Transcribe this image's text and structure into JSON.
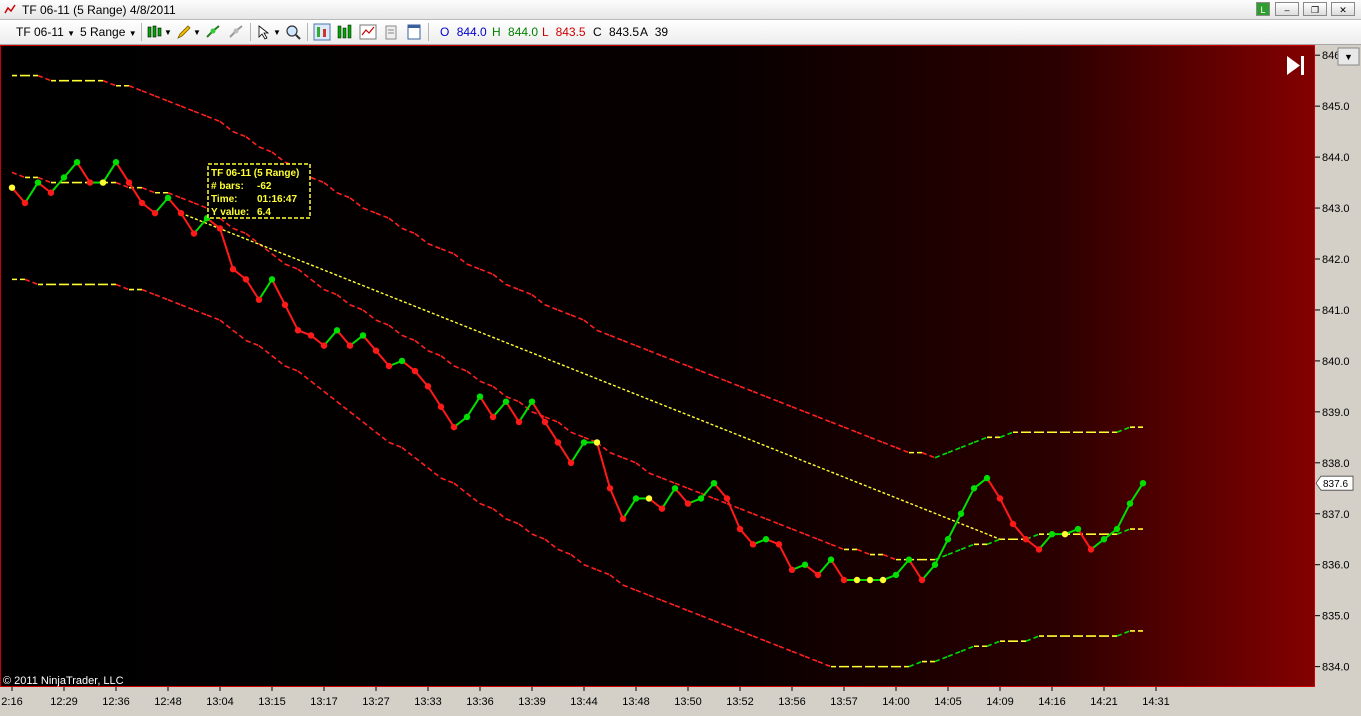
{
  "window": {
    "title": "TF 06-11 (5 Range)  4/8/2011",
    "app_icon": "chart-icon",
    "buttons": {
      "restore_icon": "restore-icon",
      "close_icon": "close-icon"
    }
  },
  "toolbar": {
    "instrument": "TF 06-11",
    "interval": "5 Range",
    "ohlc": {
      "o_label": "O",
      "o_value": "844.0",
      "h_label": "H",
      "h_value": "844.0",
      "l_label": "L",
      "l_value": "843.5",
      "c_label": "C",
      "c_value": "843.5",
      "a_label": "A",
      "a_value": "39"
    },
    "icons": [
      "bar-type-icon",
      "pencil-draw-icon",
      "add-indicator-icon",
      "strategy-icon",
      "cursor-icon",
      "zoom-icon",
      "data-box-icon",
      "chart-properties-icon",
      "indicator-icon",
      "strategy-properties-icon",
      "templates-icon"
    ],
    "colors": {
      "o": "#0000cc",
      "h": "#008000",
      "l": "#cc0000",
      "c": "#000000"
    }
  },
  "chart_data": {
    "type": "line",
    "instrument": "TF 06-11",
    "interval": "5 Range",
    "date": "4/8/2011",
    "copyright": "© 2011 NinjaTrader, LLC",
    "current_price_label": "837.6",
    "ylim": [
      833.6,
      846.2
    ],
    "yticks": [
      834.0,
      835.0,
      836.0,
      837.0,
      838.0,
      839.0,
      840.0,
      841.0,
      842.0,
      843.0,
      844.0,
      845.0,
      846.0
    ],
    "ytick_labels": [
      "834.0",
      "835.0",
      "836.0",
      "837.0",
      "838.0",
      "839.0",
      "840.0",
      "841.0",
      "842.0",
      "843.0",
      "844.0",
      "845.0",
      "846.0"
    ],
    "xticks": [
      {
        "bar": 0,
        "label": "2:16"
      },
      {
        "bar": 4,
        "label": "12:29"
      },
      {
        "bar": 8,
        "label": "12:36"
      },
      {
        "bar": 12,
        "label": "12:48"
      },
      {
        "bar": 16,
        "label": "13:04"
      },
      {
        "bar": 20,
        "label": "13:15"
      },
      {
        "bar": 24,
        "label": "13:17"
      },
      {
        "bar": 28,
        "label": "13:27"
      },
      {
        "bar": 32,
        "label": "13:33"
      },
      {
        "bar": 36,
        "label": "13:36"
      },
      {
        "bar": 40,
        "label": "13:39"
      },
      {
        "bar": 44,
        "label": "13:44"
      },
      {
        "bar": 48,
        "label": "13:48"
      },
      {
        "bar": 52,
        "label": "13:50"
      },
      {
        "bar": 56,
        "label": "13:52"
      },
      {
        "bar": 60,
        "label": "13:56"
      },
      {
        "bar": 64,
        "label": "13:57"
      },
      {
        "bar": 68,
        "label": "14:00"
      },
      {
        "bar": 72,
        "label": "14:05"
      },
      {
        "bar": 76,
        "label": "14:09"
      },
      {
        "bar": 80,
        "label": "14:16"
      },
      {
        "bar": 84,
        "label": "14:21"
      },
      {
        "bar": 88,
        "label": "14:31"
      }
    ],
    "series": [
      {
        "role": "price-close",
        "values": [
          843.4,
          843.1,
          843.5,
          843.3,
          843.6,
          843.9,
          843.5,
          843.5,
          843.9,
          843.5,
          843.1,
          842.9,
          843.2,
          842.9,
          842.5,
          842.8,
          842.6,
          841.8,
          841.6,
          841.2,
          841.6,
          841.1,
          840.6,
          840.5,
          840.3,
          840.6,
          840.3,
          840.5,
          840.2,
          839.9,
          840.0,
          839.8,
          839.5,
          839.1,
          838.7,
          838.9,
          839.3,
          838.9,
          839.2,
          838.8,
          839.2,
          838.8,
          838.4,
          838.0,
          838.4,
          838.4,
          837.5,
          836.9,
          837.3,
          837.3,
          837.1,
          837.5,
          837.2,
          837.3,
          837.6,
          837.3,
          836.7,
          836.4,
          836.5,
          836.4,
          835.9,
          836.0,
          835.8,
          836.1,
          835.7,
          835.7,
          835.7,
          835.7,
          835.8,
          836.1,
          835.7,
          836.0,
          836.5,
          837.0,
          837.5,
          837.7,
          837.3,
          836.8,
          836.5,
          836.3,
          836.6,
          836.6,
          836.7,
          836.3,
          836.5,
          836.7,
          837.2,
          837.6
        ],
        "colors": [
          "#00ff00",
          "#ff0000"
        ],
        "bar_count": 88
      },
      {
        "role": "upper-band",
        "values": [
          845.6,
          845.6,
          845.6,
          845.5,
          845.5,
          845.5,
          845.5,
          845.5,
          845.4,
          845.4,
          845.3,
          845.2,
          845.1,
          845.0,
          844.9,
          844.8,
          844.7,
          844.5,
          844.4,
          844.2,
          844.1,
          843.9,
          843.8,
          843.6,
          843.5,
          843.3,
          843.2,
          843.0,
          842.9,
          842.8,
          842.6,
          842.5,
          842.3,
          842.2,
          842.1,
          841.9,
          841.8,
          841.7,
          841.5,
          841.4,
          841.3,
          841.1,
          841.0,
          840.9,
          840.8,
          840.6,
          840.5,
          840.4,
          840.3,
          840.2,
          840.1,
          840.0,
          839.9,
          839.8,
          839.7,
          839.6,
          839.5,
          839.4,
          839.3,
          839.2,
          839.1,
          839.0,
          838.9,
          838.8,
          838.7,
          838.6,
          838.5,
          838.4,
          838.3,
          838.2,
          838.2,
          838.1,
          838.2,
          838.3,
          838.4,
          838.5,
          838.5,
          838.6,
          838.6,
          838.6,
          838.6,
          838.6,
          838.6,
          838.6,
          838.6,
          838.6,
          838.7,
          838.7
        ]
      },
      {
        "role": "middle-band",
        "values": [
          843.7,
          843.6,
          843.6,
          843.5,
          843.5,
          843.5,
          843.5,
          843.5,
          843.5,
          843.4,
          843.4,
          843.3,
          843.3,
          843.2,
          843.1,
          843.0,
          842.8,
          842.6,
          842.5,
          842.3,
          842.1,
          841.9,
          841.8,
          841.6,
          841.4,
          841.3,
          841.1,
          841.0,
          840.8,
          840.7,
          840.5,
          840.4,
          840.2,
          840.1,
          839.9,
          839.8,
          839.6,
          839.5,
          839.3,
          839.2,
          839.0,
          838.9,
          838.8,
          838.6,
          838.5,
          838.4,
          838.2,
          838.1,
          838.0,
          837.8,
          837.7,
          837.6,
          837.5,
          837.4,
          837.3,
          837.2,
          837.1,
          837.0,
          836.9,
          836.8,
          836.7,
          836.6,
          836.5,
          836.4,
          836.3,
          836.3,
          836.2,
          836.2,
          836.1,
          836.1,
          836.1,
          836.1,
          836.2,
          836.3,
          836.4,
          836.4,
          836.5,
          836.5,
          836.5,
          836.6,
          836.6,
          836.6,
          836.6,
          836.6,
          836.6,
          836.6,
          836.7,
          836.7
        ]
      },
      {
        "role": "lower-band",
        "values": [
          841.6,
          841.6,
          841.5,
          841.5,
          841.5,
          841.5,
          841.5,
          841.5,
          841.5,
          841.4,
          841.4,
          841.3,
          841.2,
          841.1,
          841.0,
          840.9,
          840.8,
          840.6,
          840.4,
          840.3,
          840.1,
          839.9,
          839.8,
          839.6,
          839.4,
          839.2,
          839.0,
          838.8,
          838.6,
          838.4,
          838.3,
          838.1,
          837.9,
          837.7,
          837.6,
          837.4,
          837.2,
          837.1,
          836.9,
          836.8,
          836.6,
          836.5,
          836.3,
          836.2,
          836.0,
          835.9,
          835.8,
          835.6,
          835.5,
          835.4,
          835.3,
          835.2,
          835.1,
          835.0,
          834.9,
          834.8,
          834.7,
          834.6,
          834.5,
          834.4,
          834.3,
          834.2,
          834.1,
          834.0,
          834.0,
          834.0,
          834.0,
          834.0,
          834.0,
          834.0,
          834.1,
          834.1,
          834.2,
          834.3,
          834.4,
          834.4,
          834.5,
          834.5,
          834.5,
          834.6,
          834.6,
          834.6,
          834.6,
          834.6,
          834.6,
          834.6,
          834.7,
          834.7
        ]
      }
    ],
    "drawing": {
      "type": "trend-line",
      "from": {
        "bar": 13,
        "y": 842.9
      },
      "to": {
        "bar": 76,
        "y": 836.5
      }
    },
    "tooltip": {
      "line1": "TF 06-11 (5 Range)",
      "line2_label": "# bars:",
      "line2_value": "-62",
      "line3_label": "Time:",
      "line3_value": "01:16:47",
      "line4_label": "Y value:",
      "line4_value": "6.4"
    },
    "colors": {
      "up": "#00e000",
      "down": "#ff1a1a",
      "neutral": "#ffff33",
      "axis_bg": "#d4d0c8",
      "band": "#ff2020"
    }
  }
}
